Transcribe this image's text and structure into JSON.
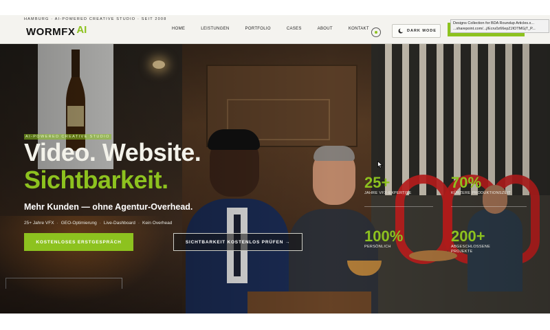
{
  "header": {
    "tagline": "HAMBURG · AI-POWERED CREATIVE STUDIO · SEIT 2008",
    "logo_word": "WORMFX",
    "logo_ai": "AI",
    "nav": [
      "HOME",
      "LEISTUNGEN",
      "PORTFOLIO",
      "CASES",
      "ABOUT",
      "KONTAKT"
    ],
    "dark_mode_label": "DARK MODE",
    "accent_color": "#8dc21f"
  },
  "tooltip": {
    "line1": "Designs Collection for BDA Roundup Articles.x...",
    "line2": "...sharepoint.com/...j/Ecru0z66epZJIOTMGjT_P..."
  },
  "hero": {
    "eyebrow": "AI-POWERED CREATIVE STUDIO",
    "headline1": "Video. Website.",
    "headline2": "Sichtbarkeit.",
    "subline": "Mehr Kunden — ohne Agentur-Overhead.",
    "features": [
      "25+ Jahre VFX",
      "GEO-Optimierung",
      "Live-Dashboard",
      "Kein Overhead"
    ],
    "feature_separator": "·",
    "primary_cta": "KOSTENLOSES ERSTGESPRÄCH",
    "secondary_cta": "SICHTBARKEIT KOSTENLOS PRÜFEN →"
  },
  "stats": [
    {
      "value": "25+",
      "label": "JAHRE VFX-EXPERTISE"
    },
    {
      "value": "70%",
      "label": "KÜRZERE PRODUKTIONSZEIT"
    },
    {
      "value": "100%",
      "label": "PERSÖNLICH"
    },
    {
      "value": "200+",
      "label": "ABGESCHLOSSENE PROJEKTE"
    }
  ]
}
